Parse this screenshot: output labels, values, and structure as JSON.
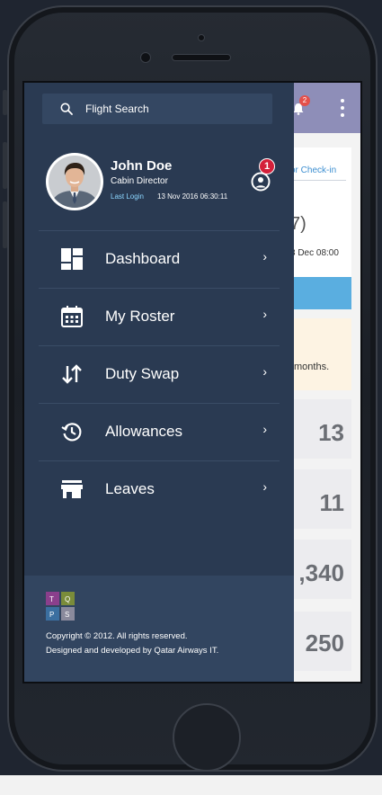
{
  "search": {
    "label": "Flight Search",
    "icon": "search-icon"
  },
  "user": {
    "name": "John Doe",
    "role": "Cabin Director",
    "last_login_label": "Last Login",
    "last_login_value": "13 Nov 2016 06:30:11",
    "notification_count": "1"
  },
  "menu": [
    {
      "label": "Dashboard",
      "icon": "dashboard-icon",
      "chevron": "›"
    },
    {
      "label": "My Roster",
      "icon": "calendar-icon",
      "chevron": "›"
    },
    {
      "label": "Duty Swap",
      "icon": "swap-icon",
      "chevron": "›"
    },
    {
      "label": "Allowances",
      "icon": "history-icon",
      "chevron": "›"
    },
    {
      "label": "Leaves",
      "icon": "store-icon",
      "chevron": "›"
    }
  ],
  "footer": {
    "logo_letters": [
      "T",
      "Q",
      "P",
      "S"
    ],
    "copyright": "Copyright © 2012. All rights reserved.",
    "developer": "Designed and developed by Qatar Airways IT."
  },
  "background": {
    "header_badge": "2",
    "link_text": "or Check-in",
    "big_value": "7)",
    "date_text": "3 Dec 08:00",
    "notice_text": "months.",
    "stats": [
      "13",
      "11",
      ",340",
      "250"
    ]
  },
  "colors": {
    "drawer": "#2a3a52",
    "header": "#8e8eb8",
    "accent_blue": "#5aaee0",
    "badge_red": "#d4203a",
    "login_label": "#8cd6ff"
  }
}
